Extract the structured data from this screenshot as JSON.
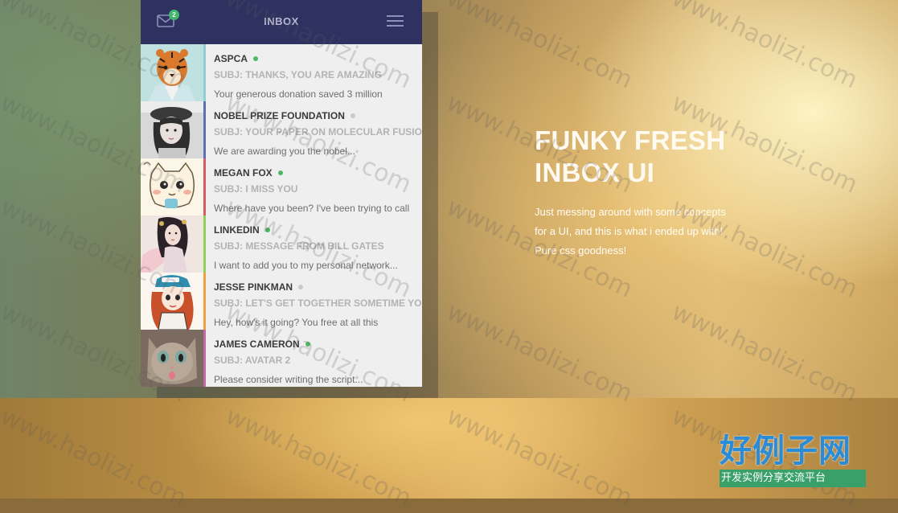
{
  "header": {
    "title": "INBOX",
    "unread_badge": "2",
    "mail_icon": "envelope-icon",
    "menu_icon": "hamburger-menu-icon"
  },
  "messages": [
    {
      "sender": "ASPCA",
      "subject": "SUBJ: THANKS, YOU ARE AMAZING",
      "preview": "Your generous donation saved 3 million",
      "status": "online",
      "stripe": "#8ed0cf",
      "avatar": "tiger-avatar"
    },
    {
      "sender": "NOBEL PRIZE FOUNDATION",
      "subject": "SUBJ: YOUR PAPER ON MOLECULAR FUSION",
      "preview": "We are awarding you the nobel...",
      "status": "offline",
      "stripe": "#5b6fb5",
      "avatar": "girl-photo-avatar"
    },
    {
      "sender": "MEGAN FOX",
      "subject": "SUBJ: I MISS YOU",
      "preview": "Where have you been? I've been trying to call",
      "status": "online",
      "stripe": "#d95a66",
      "avatar": "cartoon-cat-avatar"
    },
    {
      "sender": "LINKEDIN",
      "subject": "SUBJ: MESSAGE FROM BILL GATES",
      "preview": "I want to add you to my personal network...",
      "status": "online",
      "stripe": "#8fcf5a",
      "avatar": "illustrated-woman-avatar"
    },
    {
      "sender": "JESSE PINKMAN",
      "subject": "SUBJ: LET'S GET TOGETHER SOMETIME YO!",
      "preview": "Hey, how's it going? You free at all this",
      "status": "offline",
      "stripe": "#f0a040",
      "avatar": "cartoon-girl-cap-avatar"
    },
    {
      "sender": "JAMES CAMERON",
      "subject": "SUBJ: AVATAR 2",
      "preview": "Please consider writing the script...",
      "status": "online",
      "stripe": "#c06aa8",
      "avatar": "cat-photo-avatar"
    }
  ],
  "status_colors": {
    "online": "#4cb963",
    "offline": "#c9c9c9"
  },
  "hero": {
    "title_line1": "FUNKY FRESH",
    "title_line2": "INBOX UI",
    "description": "Just messing around with some concepts for a UI, and this is what i ended up with! Pure css goodness!"
  },
  "watermark": {
    "text": "www.haolizi.com"
  },
  "logo": {
    "main": "好例子网",
    "sub": "开发实例分享交流平台"
  }
}
